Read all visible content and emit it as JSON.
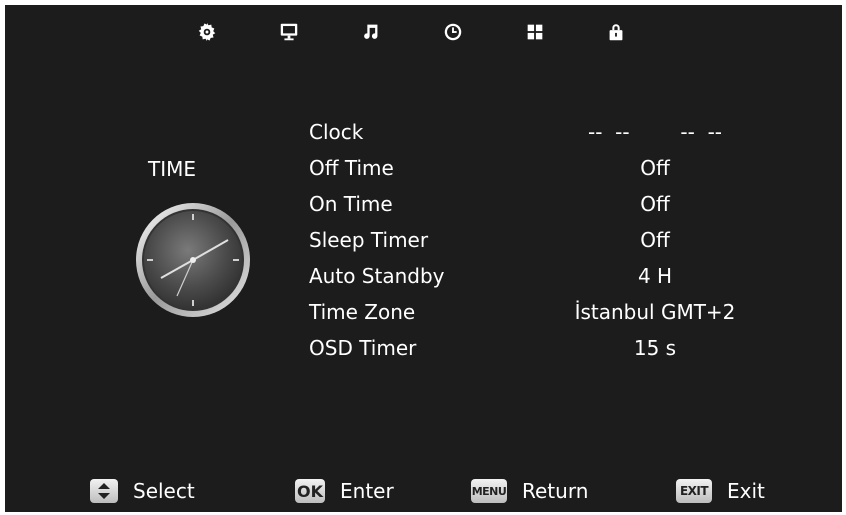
{
  "top_tabs": [
    {
      "name": "picture",
      "icon": "gear-icon"
    },
    {
      "name": "channel",
      "icon": "monitor-icon"
    },
    {
      "name": "sound",
      "icon": "music-note-icon"
    },
    {
      "name": "time",
      "icon": "clock-icon",
      "selected": true
    },
    {
      "name": "setup",
      "icon": "grid-icon"
    },
    {
      "name": "lock",
      "icon": "lock-icon"
    }
  ],
  "section": {
    "title": "TIME",
    "image": "analog-clock"
  },
  "menu": [
    {
      "label": "Clock",
      "value": "--  --        --  --"
    },
    {
      "label": "Off Time",
      "value": "Off"
    },
    {
      "label": "On Time",
      "value": "Off"
    },
    {
      "label": "Sleep Timer",
      "value": "Off"
    },
    {
      "label": "Auto Standby",
      "value": "4 H"
    },
    {
      "label": "Time Zone",
      "value": "İstanbul GMT+2"
    },
    {
      "label": "OSD Timer",
      "value": "15 s"
    }
  ],
  "hints": [
    {
      "key": "",
      "key_icon": "up-down-arrows-icon",
      "label": "Select"
    },
    {
      "key": "OK",
      "label": "Enter"
    },
    {
      "key": "MENU",
      "label": "Return"
    },
    {
      "key": "EXIT",
      "label": "Exit"
    }
  ],
  "colors": {
    "background": "#1c1c1c",
    "text": "#ffffff",
    "key_bg": "#d9d9d9"
  }
}
